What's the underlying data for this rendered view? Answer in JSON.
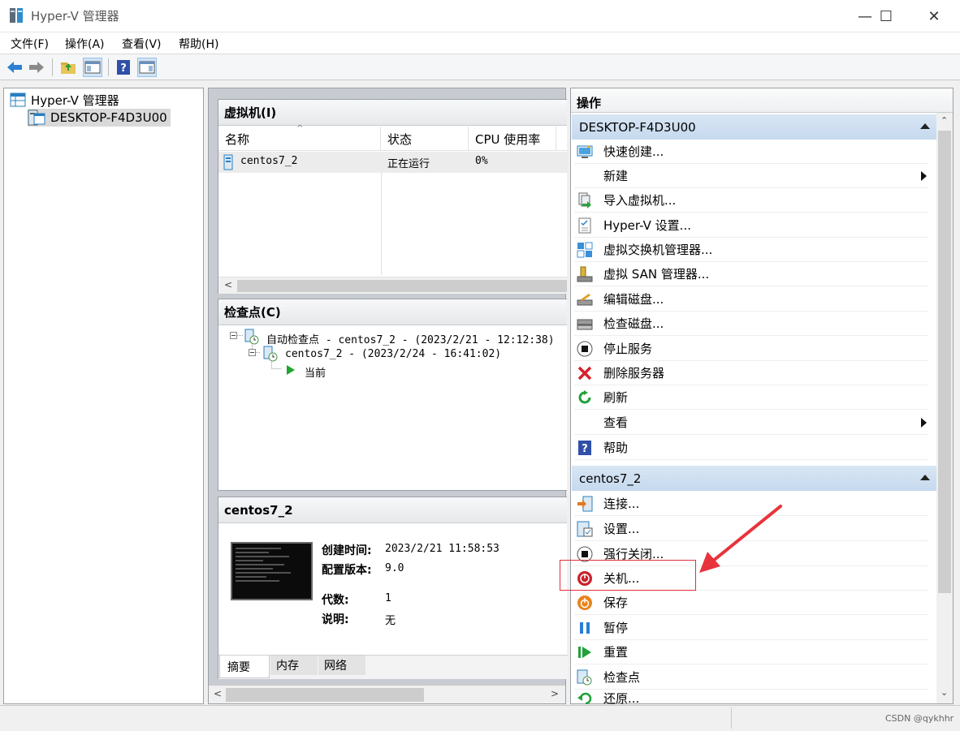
{
  "window": {
    "title": "Hyper-V 管理器",
    "minimize": "—",
    "maximize": "☐",
    "close": "✕"
  },
  "menu": [
    "文件(F)",
    "操作(A)",
    "查看(V)",
    "帮助(H)"
  ],
  "tree": {
    "root": "Hyper-V 管理器",
    "host": "DESKTOP-F4D3U00"
  },
  "vms": {
    "title": "虚拟机(I)",
    "columns": [
      "名称",
      "状态",
      "CPU 使用率"
    ],
    "rows": [
      {
        "name": "centos7_2",
        "state": "正在运行",
        "cpu": "0%"
      }
    ]
  },
  "checkpoints": {
    "title": "检查点(C)",
    "items": [
      "自动检查点 - centos7_2 - (2023/2/21 - 12:12:38)",
      "centos7_2 - (2023/2/24 - 16:41:02)",
      "当前"
    ]
  },
  "details": {
    "title": "centos7_2",
    "created_label": "创建时间:",
    "created_value": "2023/2/21 11:58:53",
    "version_label": "配置版本:",
    "version_value": "9.0",
    "gen_label": "代数:",
    "gen_value": "1",
    "notes_label": "说明:",
    "notes_value": "无",
    "tabs": [
      "摘要",
      "内存",
      "网络"
    ]
  },
  "actions": {
    "title": "操作",
    "host_group": {
      "title": "DESKTOP-F4D3U00",
      "items": [
        "快速创建...",
        "新建",
        "导入虚拟机...",
        "Hyper-V 设置...",
        "虚拟交换机管理器...",
        "虚拟 SAN 管理器...",
        "编辑磁盘...",
        "检查磁盘...",
        "停止服务",
        "删除服务器",
        "刷新",
        "查看",
        "帮助"
      ]
    },
    "vm_group": {
      "title": "centos7_2",
      "items": [
        "连接...",
        "设置...",
        "强行关闭...",
        "关机...",
        "保存",
        "暂停",
        "重置",
        "检查点",
        "还原..."
      ]
    }
  },
  "watermark": "CSDN @qykhhr",
  "colors": {
    "highlight_box": "#e0303a",
    "arrow": "#e8333c",
    "group_header": "#c9dcf0"
  }
}
